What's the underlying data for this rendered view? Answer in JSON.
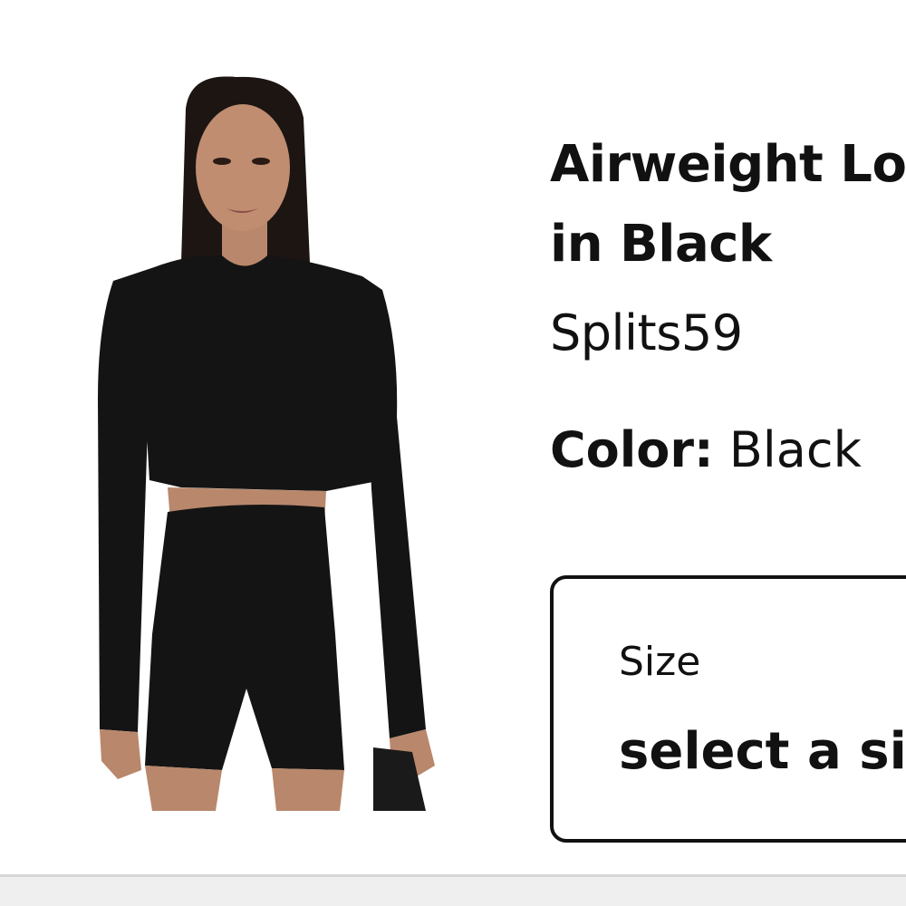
{
  "product": {
    "title_line1": "Airweight Long Sleeve Crop Top",
    "title_line2": "in Black",
    "brand": "Splits59",
    "color_label": "Color:",
    "color_value": "Black",
    "image_alt": "Model wearing black long sleeve crop top and black biker shorts"
  },
  "size_selector": {
    "label": "Size",
    "value": "select a size"
  },
  "colors": {
    "garment": "#141414",
    "skin": "#b9876b",
    "hair": "#1c1512",
    "border": "#111111"
  }
}
